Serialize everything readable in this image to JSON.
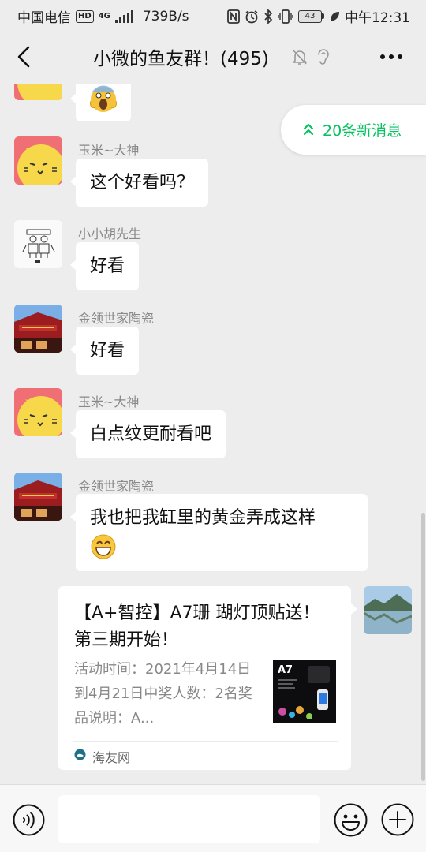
{
  "status_bar": {
    "carrier": "中国电信",
    "hd": "HD",
    "network": "4G",
    "speed": "739B/s",
    "battery": "43",
    "time": "中午12:31"
  },
  "header": {
    "title": "小微的鱼友群！(495)"
  },
  "new_messages": {
    "label": "20条新消息"
  },
  "messages": [
    {
      "sender": "玉米~大神",
      "text": "这个好看吗？"
    },
    {
      "sender": "小小胡先生",
      "text": "好看"
    },
    {
      "sender": "金领世家陶瓷",
      "text": "好看"
    },
    {
      "sender": "玉米~大神",
      "text": "白点纹更耐看吧"
    },
    {
      "sender": "金领世家陶瓷",
      "text": "我也把我缸里的黄金弄成这样"
    }
  ],
  "link_card": {
    "title": "【A+智控】A7珊 瑚灯顶贴送！ 第三期开始！",
    "description": "活动时间：2021年4月14日到4月21日中奖人数：2名奖品说明：A...",
    "thumb_label": "A7",
    "source": "海友网"
  },
  "input_bar": {
    "value": ""
  },
  "icons": {
    "back": "back-arrow-icon",
    "mute": "mute-bell-icon",
    "ear": "earpiece-icon",
    "more": "more-icon",
    "scroll_up": "double-chevron-up-icon",
    "source": "source-logo-icon",
    "voice": "voice-icon",
    "emoji": "emoji-icon",
    "plus": "plus-icon"
  },
  "colors": {
    "background": "#ededed",
    "accent": "#07c160",
    "bubble": "#ffffff"
  }
}
